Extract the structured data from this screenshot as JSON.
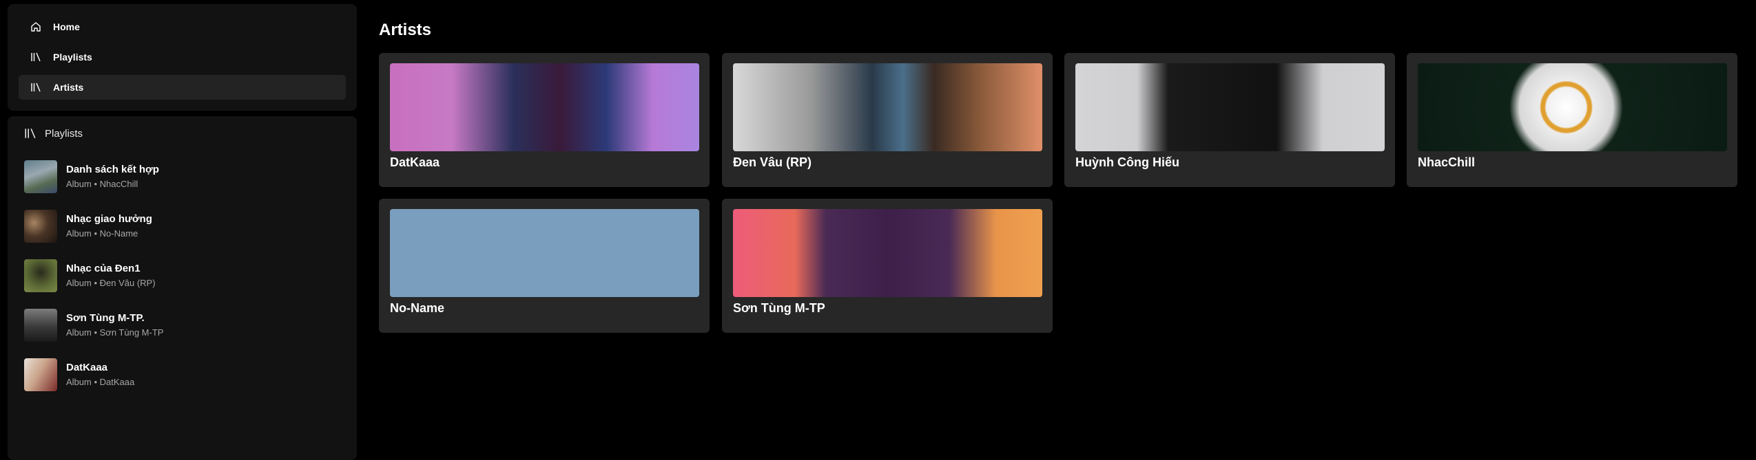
{
  "nav": {
    "items": [
      {
        "label": "Home",
        "icon": "home-icon",
        "active": false
      },
      {
        "label": "Playlists",
        "icon": "library-icon",
        "active": false
      },
      {
        "label": "Artists",
        "icon": "library-icon",
        "active": true
      }
    ]
  },
  "library": {
    "title": "Playlists",
    "icon": "library-icon",
    "items": [
      {
        "title": "Danh sách kết hợp",
        "subtitle": "Album • NhacChill"
      },
      {
        "title": "Nhạc giao hưởng",
        "subtitle": "Album • No-Name"
      },
      {
        "title": "Nhạc của Đen1",
        "subtitle": "Album • Đen Vâu (RP)"
      },
      {
        "title": "Sơn Tùng M-TP.",
        "subtitle": "Album • Sơn Tùng M-TP"
      },
      {
        "title": "DatKaaa",
        "subtitle": "Album • DatKaaa"
      }
    ]
  },
  "main": {
    "title": "Artists",
    "artists": [
      {
        "name": "DatKaaa"
      },
      {
        "name": "Đen Vâu (RP)"
      },
      {
        "name": "Huỳnh Công Hiếu"
      },
      {
        "name": "NhacChill"
      },
      {
        "name": "No-Name"
      },
      {
        "name": "Sơn Tùng M-TP"
      }
    ]
  },
  "colors": {
    "background": "#000000",
    "panel": "#121212",
    "card": "#272727",
    "active_nav": "#232323",
    "text_primary": "#ffffff",
    "text_secondary": "#a7a7a7"
  }
}
